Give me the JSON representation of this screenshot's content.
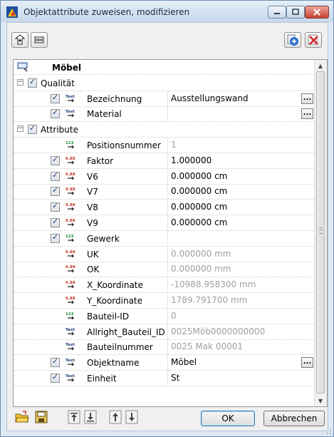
{
  "window": {
    "title": "Objektattribute zuweisen, modifizieren",
    "colors": {
      "accent": "#3c7fb1",
      "close": "#c9422f",
      "readonly_text": "#a0a0a0",
      "integer_icon": "#1d8a2e",
      "decimal_icon": "#c0392b"
    }
  },
  "toolbar": {
    "left_buttons": [
      "add-attribute-icon",
      "list-icon"
    ],
    "right_buttons": [
      "add-icon",
      "delete-icon"
    ]
  },
  "grid": {
    "header": {
      "name": "Möbel"
    },
    "groups": [
      {
        "label": "Qualität",
        "expanded": true,
        "checked": true
      },
      {
        "label": "Attribute",
        "expanded": true,
        "checked": true
      }
    ],
    "rows": [
      {
        "name": "Bezeichnung",
        "value": "Ausstellungswand",
        "type": "text",
        "checked": true,
        "readonly": false,
        "browse": true
      },
      {
        "name": "Material",
        "value": "",
        "type": "text",
        "checked": true,
        "readonly": false,
        "browse": true
      },
      {
        "name": "Positionsnummer",
        "value": "1",
        "type": "integer",
        "checked": false,
        "readonly": true,
        "browse": false
      },
      {
        "name": "Faktor",
        "value": "1.000000",
        "type": "decimal",
        "checked": true,
        "readonly": false,
        "browse": false
      },
      {
        "name": "V6",
        "value": "0.000000 cm",
        "type": "decimal",
        "checked": true,
        "readonly": false,
        "browse": false
      },
      {
        "name": "V7",
        "value": "0.000000 cm",
        "type": "decimal",
        "checked": true,
        "readonly": false,
        "browse": false
      },
      {
        "name": "V8",
        "value": "0.000000 cm",
        "type": "decimal",
        "checked": true,
        "readonly": false,
        "browse": false
      },
      {
        "name": "V9",
        "value": "0.000000 cm",
        "type": "decimal",
        "checked": true,
        "readonly": false,
        "browse": false
      },
      {
        "name": "Gewerk",
        "value": "",
        "type": "integer",
        "checked": true,
        "readonly": false,
        "browse": false
      },
      {
        "name": "UK",
        "value": "0.000000 mm",
        "type": "decimal",
        "checked": false,
        "readonly": true,
        "browse": false
      },
      {
        "name": "OK",
        "value": "0.000000 mm",
        "type": "decimal",
        "checked": false,
        "readonly": true,
        "browse": false
      },
      {
        "name": "X_Koordinate",
        "value": "-10988.958300 mm",
        "type": "decimal",
        "checked": false,
        "readonly": true,
        "browse": false
      },
      {
        "name": "Y_Koordinate",
        "value": "1789.791700 mm",
        "type": "decimal",
        "checked": false,
        "readonly": true,
        "browse": false
      },
      {
        "name": "Bauteil-ID",
        "value": "0",
        "type": "integer",
        "checked": false,
        "readonly": true,
        "browse": false
      },
      {
        "name": "Allright_Bauteil_ID",
        "value": "0025Möb0000000000",
        "type": "text",
        "checked": false,
        "readonly": true,
        "browse": false
      },
      {
        "name": "Bauteilnummer",
        "value": "0025 Mak 00001",
        "type": "text",
        "checked": false,
        "readonly": true,
        "browse": false
      },
      {
        "name": "Objektname",
        "value": "Möbel",
        "type": "text",
        "checked": true,
        "readonly": false,
        "browse": true
      },
      {
        "name": "Einheit",
        "value": "St",
        "type": "text",
        "checked": true,
        "readonly": false,
        "browse": false
      }
    ]
  },
  "footer": {
    "icon_buttons": [
      "open-folder-icon",
      "save-icon",
      "move-top-icon",
      "move-bottom-icon",
      "move-up-icon",
      "move-down-icon"
    ],
    "ok_label": "OK",
    "cancel_label": "Abbrechen"
  }
}
